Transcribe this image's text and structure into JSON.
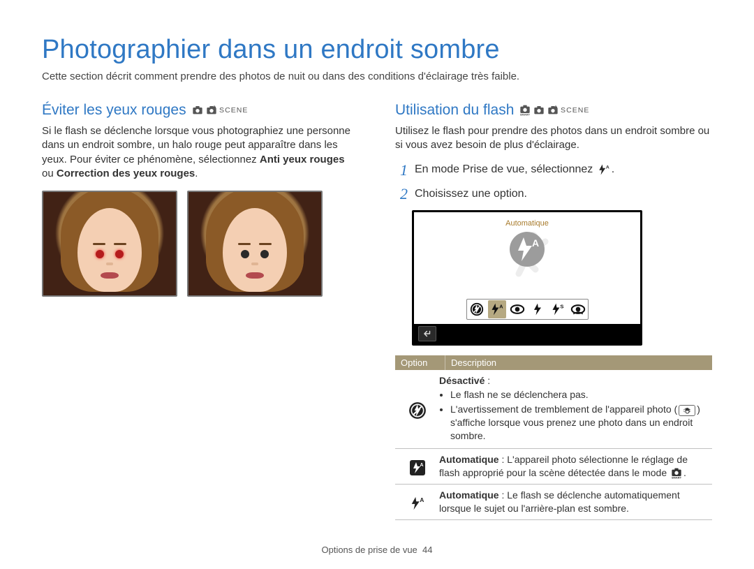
{
  "title": "Photographier dans un endroit sombre",
  "intro": "Cette section décrit comment prendre des photos de nuit ou dans des conditions d'éclairage très faible.",
  "left": {
    "heading": "Éviter les yeux rouges",
    "scene": "SCENE",
    "para_a": "Si le flash se déclenche lorsque vous photographiez une personne dans un endroit sombre, un halo rouge peut apparaître dans les yeux. Pour éviter ce phénomène, sélectionnez ",
    "para_b_bold": "Anti yeux rouges",
    "para_c": " ou ",
    "para_d_bold": "Correction des yeux rouges",
    "para_e": "."
  },
  "right": {
    "heading": "Utilisation du flash",
    "scene": "SCENE",
    "para": "Utilisez le flash pour prendre des photos dans un endroit sombre ou si vous avez besoin de plus d'éclairage.",
    "step1_num": "1",
    "step1_text": "En mode Prise de vue, sélectionnez ",
    "step1_trail": ".",
    "step2_num": "2",
    "step2_text": "Choisissez une option.",
    "screen_label": "Automatique",
    "thead_option": "Option",
    "thead_desc": "Description",
    "row1_title": "Désactivé",
    "row1_colon": " :",
    "row1_b1": "Le flash ne se déclenchera pas.",
    "row1_b2a": "L'avertissement de tremblement de l'appareil photo (",
    "row1_b2b": ") s'affiche lorsque vous prenez une photo dans un endroit sombre.",
    "row2_title": "Automatique",
    "row2_text": " : L'appareil photo sélectionne le réglage de flash approprié pour la scène détectée dans le mode ",
    "row2_trail": ".",
    "row3_title": "Automatique",
    "row3_text": " : Le flash se déclenche automatiquement lorsque le sujet ou l'arrière-plan est sombre."
  },
  "footer_label": "Options de prise de vue",
  "footer_page": "44"
}
